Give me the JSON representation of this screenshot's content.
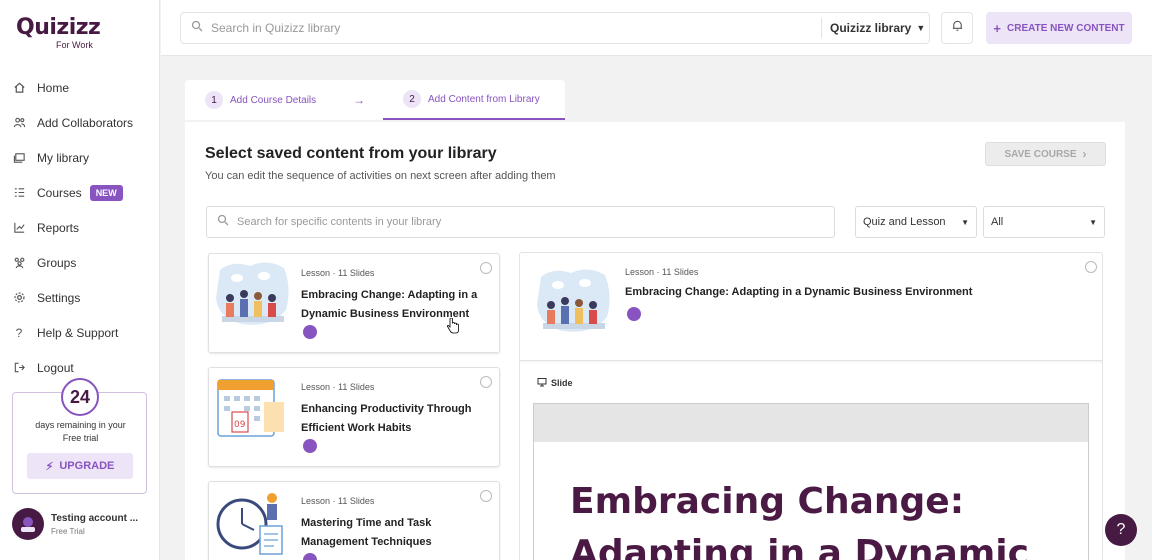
{
  "brand": {
    "name": "Quizizz",
    "sub": "For Work"
  },
  "sidebar": {
    "items": [
      {
        "label": "Home",
        "icon": "home-icon"
      },
      {
        "label": "Add Collaborators",
        "icon": "users-icon"
      },
      {
        "label": "My library",
        "icon": "library-icon"
      },
      {
        "label": "Courses",
        "icon": "courses-icon",
        "badge": "NEW"
      },
      {
        "label": "Reports",
        "icon": "reports-icon"
      },
      {
        "label": "Groups",
        "icon": "groups-icon"
      },
      {
        "label": "Settings",
        "icon": "gear-icon"
      },
      {
        "label": "Help & Support",
        "icon": "help-icon"
      },
      {
        "label": "Logout",
        "icon": "logout-icon"
      }
    ]
  },
  "trial": {
    "days": "24",
    "text_line1": "days remaining in your",
    "text_line2": "Free trial",
    "upgrade_label": "UPGRADE"
  },
  "account": {
    "name": "Testing account ...",
    "plan": "Free Trial"
  },
  "topbar": {
    "search_placeholder": "Search in Quizizz library",
    "library_select": "Quizizz library",
    "create_label": "CREATE NEW CONTENT"
  },
  "steps": [
    {
      "num": "1",
      "label": "Add Course Details"
    },
    {
      "num": "2",
      "label": "Add Content from Library"
    }
  ],
  "main": {
    "title": "Select saved content from your library",
    "subtitle": "You can edit the sequence of activities on next screen after adding them",
    "save_label": "SAVE COURSE",
    "search_placeholder": "Search for specific contents in your library",
    "filter_type": "Quiz and Lesson",
    "filter_scope": "All"
  },
  "cards": [
    {
      "meta": "Lesson · 11 Slides",
      "title": "Embracing Change: Adapting in a Dynamic Business Environment"
    },
    {
      "meta": "Lesson · 11 Slides",
      "title": "Enhancing Productivity Through Efficient Work Habits"
    },
    {
      "meta": "Lesson · 11 Slides",
      "title": "Mastering Time and Task Management Techniques"
    }
  ],
  "preview": {
    "meta": "Lesson · 11 Slides",
    "title": "Embracing Change: Adapting in a Dynamic Business Environment",
    "slide_label": "Slide",
    "slide_line1": "Embracing Change:",
    "slide_line2": "Adapting in a Dynamic"
  },
  "colors": {
    "brand_dark": "#461a42",
    "accent": "#8854c0",
    "accent_light": "#ede4f7"
  }
}
